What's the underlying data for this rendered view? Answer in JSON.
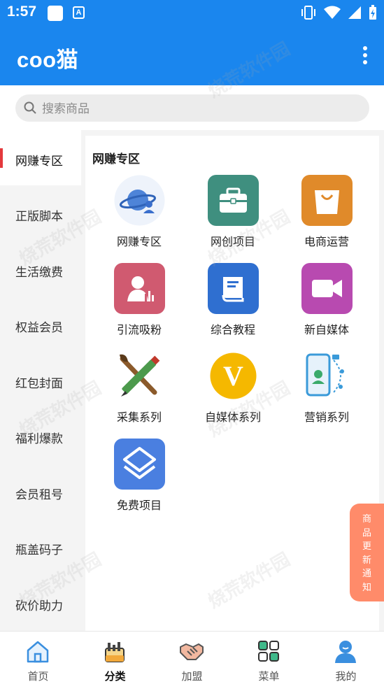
{
  "status_bar": {
    "time": "1:57",
    "a_icon": "A"
  },
  "app_bar": {
    "title": "coo猫"
  },
  "search": {
    "placeholder": "搜索商品"
  },
  "sidebar": {
    "active_index": 0,
    "items": [
      {
        "label": "网赚专区"
      },
      {
        "label": "正版脚本"
      },
      {
        "label": "生活缴费"
      },
      {
        "label": "权益会员"
      },
      {
        "label": "红包封面"
      },
      {
        "label": "福利爆款"
      },
      {
        "label": "会员租号"
      },
      {
        "label": "瓶盖码子"
      },
      {
        "label": "砍价助力"
      }
    ]
  },
  "content": {
    "section_title": "网赚专区",
    "items": [
      {
        "label": "网赚专区",
        "icon": "planet-user-icon"
      },
      {
        "label": "网创项目",
        "icon": "briefcase-icon"
      },
      {
        "label": "电商运营",
        "icon": "shopping-bag-icon"
      },
      {
        "label": "引流吸粉",
        "icon": "person-icon"
      },
      {
        "label": "综合教程",
        "icon": "book-icon"
      },
      {
        "label": "新自媒体",
        "icon": "video-camera-icon"
      },
      {
        "label": "采集系列",
        "icon": "pencil-brush-icon"
      },
      {
        "label": "自媒体系列",
        "icon": "v-badge-icon",
        "glyph": "V"
      },
      {
        "label": "营销系列",
        "icon": "phone-marketing-icon"
      },
      {
        "label": "免费项目",
        "icon": "layers-icon"
      }
    ]
  },
  "notice": {
    "label": "商品更新通知"
  },
  "bottom_nav": {
    "active_index": 1,
    "items": [
      {
        "label": "首页",
        "icon": "home-icon"
      },
      {
        "label": "分类",
        "icon": "category-icon"
      },
      {
        "label": "加盟",
        "icon": "handshake-icon"
      },
      {
        "label": "菜单",
        "icon": "grid-menu-icon"
      },
      {
        "label": "我的",
        "icon": "user-icon"
      }
    ]
  },
  "watermark": {
    "text": "烧荒软件园"
  },
  "colors": {
    "primary": "#1a86ee",
    "active_bar": "#e4393c",
    "notice": "#ff8b6a",
    "tile_briefcase": "#3f8f7f",
    "tile_bag": "#e08a2a",
    "tile_person": "#d05a70",
    "tile_book": "#2f6fd0",
    "tile_video": "#b84ab0",
    "tile_layers": "#4a7fe0",
    "v_badge": "#f5b800"
  }
}
